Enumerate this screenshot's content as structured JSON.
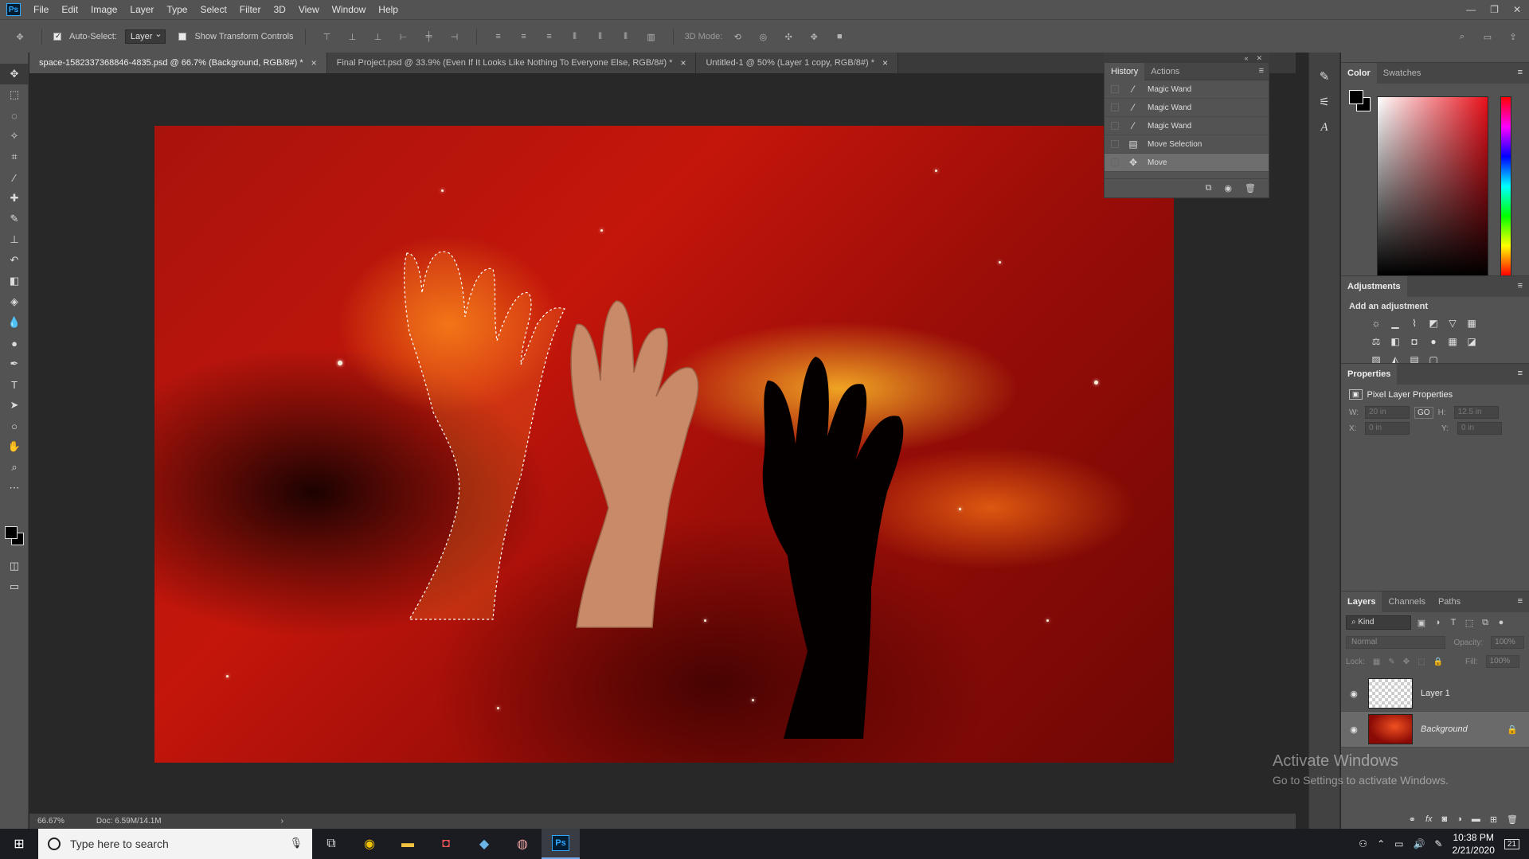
{
  "app": {
    "logo": "Ps"
  },
  "menubar": {
    "items": [
      "File",
      "Edit",
      "Image",
      "Layer",
      "Type",
      "Select",
      "Filter",
      "3D",
      "View",
      "Window",
      "Help"
    ],
    "window_controls": [
      "—",
      "❐",
      "✕"
    ]
  },
  "options": {
    "auto_select_label": "Auto-Select:",
    "auto_select_value": "Layer",
    "show_transform_label": "Show Transform Controls",
    "mode_label": "3D Mode:"
  },
  "tabs": [
    {
      "label": "space-1582337368846-4835.psd @ 66.7% (Background, RGB/8#) *",
      "active": true
    },
    {
      "label": "Final Project.psd @ 33.9% (Even If It Looks Like Nothing To Everyone Else, RGB/8#) *",
      "active": false
    },
    {
      "label": "Untitled-1 @ 50% (Layer 1 copy, RGB/8#) *",
      "active": false
    }
  ],
  "history": {
    "tabs": [
      "History",
      "Actions"
    ],
    "items": [
      {
        "label": "Magic Wand",
        "icon": "magic-wand-icon"
      },
      {
        "label": "Magic Wand",
        "icon": "magic-wand-icon"
      },
      {
        "label": "Magic Wand",
        "icon": "magic-wand-icon"
      },
      {
        "label": "Move Selection",
        "icon": "move-selection-icon"
      },
      {
        "label": "Move",
        "icon": "move-icon"
      }
    ]
  },
  "color_panel": {
    "tabs": [
      "Color",
      "Swatches"
    ],
    "foreground": "#000000",
    "background": "#000000"
  },
  "adjustments": {
    "tab": "Adjustments",
    "title": "Add an adjustment"
  },
  "properties": {
    "tab": "Properties",
    "title": "Pixel Layer Properties",
    "w_label": "W:",
    "w_value": "20 in",
    "h_label": "H:",
    "h_value": "12.5 in",
    "x_label": "X:",
    "x_value": "0 in",
    "y_label": "Y:",
    "y_value": "0 in",
    "link_label": "GO"
  },
  "layers": {
    "tabs": [
      "Layers",
      "Channels",
      "Paths"
    ],
    "kind_label": "Kind",
    "blend_mode": "Normal",
    "opacity_label": "Opacity:",
    "opacity_value": "100%",
    "lock_label": "Lock:",
    "fill_label": "Fill:",
    "fill_value": "100%",
    "items": [
      {
        "name": "Layer 1",
        "selected": false
      },
      {
        "name": "Background",
        "selected": true
      }
    ]
  },
  "status": {
    "zoom": "66.67%",
    "doc": "Doc: 6.59M/14.1M"
  },
  "watermark": {
    "line1": "Activate Windows",
    "line2": "Go to Settings to activate Windows."
  },
  "taskbar": {
    "search_placeholder": "Type here to search",
    "time": "10:38 PM",
    "date": "2/21/2020",
    "notification_count": "21"
  }
}
